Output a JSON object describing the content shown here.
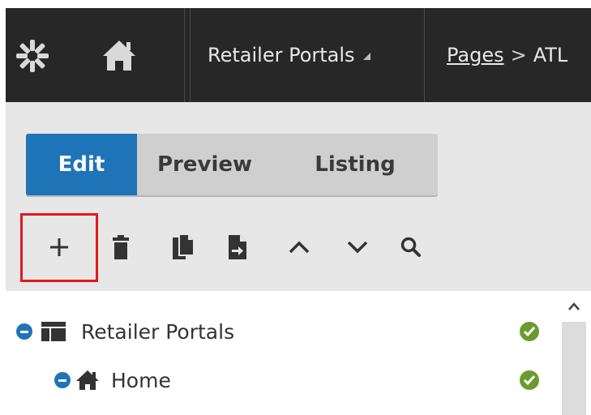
{
  "topbar": {
    "logo_icon": "asterisk-logo-icon",
    "home_icon": "home-icon",
    "portal_menu_label": "Retailer Portals",
    "breadcrumb_link": "Pages",
    "breadcrumb_separator": ">",
    "breadcrumb_current": "ATL"
  },
  "tabs": [
    {
      "label": "Edit",
      "active": true
    },
    {
      "label": "Preview",
      "active": false
    },
    {
      "label": "Listing",
      "active": false
    }
  ],
  "toolbar": {
    "add": "+",
    "icons": [
      "plus-icon",
      "trash-icon",
      "copy-icon",
      "move-icon",
      "chevron-up-icon",
      "chevron-down-icon",
      "search-icon"
    ]
  },
  "tree": {
    "nodes": [
      {
        "label": "Retailer Portals",
        "icon": "layout-icon",
        "status": "check-icon"
      },
      {
        "label": "Home",
        "icon": "home-icon",
        "status": "check-icon"
      }
    ]
  },
  "colors": {
    "topbar_bg": "#272727",
    "workspace_bg": "#e7e7e7",
    "accent": "#1f74b7",
    "highlight": "#e11a1a",
    "status_ok": "#6c9a2f"
  }
}
